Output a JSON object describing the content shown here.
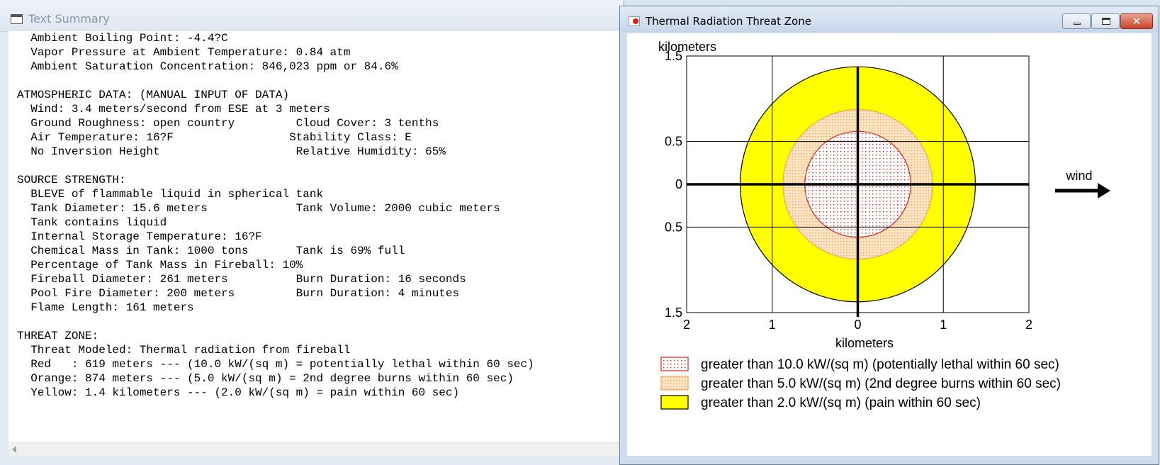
{
  "text_summary": {
    "title": "Text Summary",
    "lines": [
      "  Ambient Boiling Point: -4.4?C",
      "  Vapor Pressure at Ambient Temperature: 0.84 atm",
      "  Ambient Saturation Concentration: 846,023 ppm or 84.6%",
      "",
      "ATMOSPHERIC DATA: (MANUAL INPUT OF DATA)",
      "  Wind: 3.4 meters/second from ESE at 3 meters",
      "  Ground Roughness: open country         Cloud Cover: 3 tenths",
      "  Air Temperature: 16?F                 Stability Class: E",
      "  No Inversion Height                    Relative Humidity: 65%",
      "",
      "SOURCE STRENGTH:",
      "  BLEVE of flammable liquid in spherical tank",
      "  Tank Diameter: 15.6 meters             Tank Volume: 2000 cubic meters",
      "  Tank contains liquid",
      "  Internal Storage Temperature: 16?F",
      "  Chemical Mass in Tank: 1000 tons       Tank is 69% full",
      "  Percentage of Tank Mass in Fireball: 10%",
      "  Fireball Diameter: 261 meters          Burn Duration: 16 seconds",
      "  Pool Fire Diameter: 200 meters         Burn Duration: 4 minutes",
      "  Flame Length: 161 meters",
      "",
      "THREAT ZONE:",
      "  Threat Modeled: Thermal radiation from fireball",
      "  Red   : 619 meters --- (10.0 kW/(sq m) = potentially lethal within 60 sec)",
      "  Orange: 874 meters --- (5.0 kW/(sq m) = 2nd degree burns within 60 sec)",
      "  Yellow: 1.4 kilometers --- (2.0 kW/(sq m) = pain within 60 sec)"
    ]
  },
  "threat_window": {
    "title": "Thermal Radiation Threat Zone",
    "wind_label": "wind"
  },
  "chart_data": {
    "type": "threat-zone",
    "xlabel": "kilometers",
    "ylabel": "kilometers",
    "xlim": [
      -2,
      2
    ],
    "ylim": [
      -1.5,
      1.5
    ],
    "x_ticks": [
      -2,
      -1,
      0,
      1,
      2
    ],
    "x_tick_labels": [
      "2",
      "1",
      "0",
      "1",
      "2"
    ],
    "y_ticks": [
      1.5,
      0.5,
      0,
      -0.5,
      -1.5
    ],
    "y_tick_labels": [
      "1.5",
      "0.5",
      "0",
      "0.5",
      "1.5"
    ],
    "grid": true,
    "zones": [
      {
        "name": "yellow",
        "radius_km": 1.374,
        "fill": "#ffff00",
        "stroke": "#000000",
        "pattern": "solid"
      },
      {
        "name": "orange",
        "radius_km": 0.874,
        "fill": "#fbe3c4",
        "stroke": "#f5a35c",
        "pattern": "dotted-orange"
      },
      {
        "name": "red",
        "radius_km": 0.619,
        "fill": "#fde8ec",
        "stroke": "#e2231a",
        "pattern": "dotted-red"
      }
    ],
    "legend": [
      {
        "label": "greater than 10.0 kW/(sq m) (potentially lethal within 60 sec)",
        "zone": "red"
      },
      {
        "label": "greater than 5.0 kW/(sq m) (2nd degree burns within 60 sec)",
        "zone": "orange"
      },
      {
        "label": "greater than 2.0 kW/(sq m) (pain within 60 sec)",
        "zone": "yellow"
      }
    ]
  }
}
